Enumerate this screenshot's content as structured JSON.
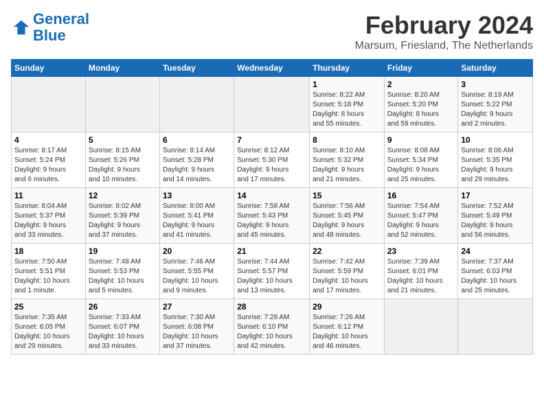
{
  "header": {
    "logo_line1": "General",
    "logo_line2": "Blue",
    "title": "February 2024",
    "subtitle": "Marsum, Friesland, The Netherlands"
  },
  "days_of_week": [
    "Sunday",
    "Monday",
    "Tuesday",
    "Wednesday",
    "Thursday",
    "Friday",
    "Saturday"
  ],
  "weeks": [
    [
      {
        "day": "",
        "info": ""
      },
      {
        "day": "",
        "info": ""
      },
      {
        "day": "",
        "info": ""
      },
      {
        "day": "",
        "info": ""
      },
      {
        "day": "1",
        "info": "Sunrise: 8:22 AM\nSunset: 5:18 PM\nDaylight: 8 hours\nand 55 minutes."
      },
      {
        "day": "2",
        "info": "Sunrise: 8:20 AM\nSunset: 5:20 PM\nDaylight: 8 hours\nand 59 minutes."
      },
      {
        "day": "3",
        "info": "Sunrise: 8:19 AM\nSunset: 5:22 PM\nDaylight: 9 hours\nand 2 minutes."
      }
    ],
    [
      {
        "day": "4",
        "info": "Sunrise: 8:17 AM\nSunset: 5:24 PM\nDaylight: 9 hours\nand 6 minutes."
      },
      {
        "day": "5",
        "info": "Sunrise: 8:15 AM\nSunset: 5:26 PM\nDaylight: 9 hours\nand 10 minutes."
      },
      {
        "day": "6",
        "info": "Sunrise: 8:14 AM\nSunset: 5:28 PM\nDaylight: 9 hours\nand 14 minutes."
      },
      {
        "day": "7",
        "info": "Sunrise: 8:12 AM\nSunset: 5:30 PM\nDaylight: 9 hours\nand 17 minutes."
      },
      {
        "day": "8",
        "info": "Sunrise: 8:10 AM\nSunset: 5:32 PM\nDaylight: 9 hours\nand 21 minutes."
      },
      {
        "day": "9",
        "info": "Sunrise: 8:08 AM\nSunset: 5:34 PM\nDaylight: 9 hours\nand 25 minutes."
      },
      {
        "day": "10",
        "info": "Sunrise: 8:06 AM\nSunset: 5:35 PM\nDaylight: 9 hours\nand 29 minutes."
      }
    ],
    [
      {
        "day": "11",
        "info": "Sunrise: 8:04 AM\nSunset: 5:37 PM\nDaylight: 9 hours\nand 33 minutes."
      },
      {
        "day": "12",
        "info": "Sunrise: 8:02 AM\nSunset: 5:39 PM\nDaylight: 9 hours\nand 37 minutes."
      },
      {
        "day": "13",
        "info": "Sunrise: 8:00 AM\nSunset: 5:41 PM\nDaylight: 9 hours\nand 41 minutes."
      },
      {
        "day": "14",
        "info": "Sunrise: 7:58 AM\nSunset: 5:43 PM\nDaylight: 9 hours\nand 45 minutes."
      },
      {
        "day": "15",
        "info": "Sunrise: 7:56 AM\nSunset: 5:45 PM\nDaylight: 9 hours\nand 48 minutes."
      },
      {
        "day": "16",
        "info": "Sunrise: 7:54 AM\nSunset: 5:47 PM\nDaylight: 9 hours\nand 52 minutes."
      },
      {
        "day": "17",
        "info": "Sunrise: 7:52 AM\nSunset: 5:49 PM\nDaylight: 9 hours\nand 56 minutes."
      }
    ],
    [
      {
        "day": "18",
        "info": "Sunrise: 7:50 AM\nSunset: 5:51 PM\nDaylight: 10 hours\nand 1 minute."
      },
      {
        "day": "19",
        "info": "Sunrise: 7:48 AM\nSunset: 5:53 PM\nDaylight: 10 hours\nand 5 minutes."
      },
      {
        "day": "20",
        "info": "Sunrise: 7:46 AM\nSunset: 5:55 PM\nDaylight: 10 hours\nand 9 minutes."
      },
      {
        "day": "21",
        "info": "Sunrise: 7:44 AM\nSunset: 5:57 PM\nDaylight: 10 hours\nand 13 minutes."
      },
      {
        "day": "22",
        "info": "Sunrise: 7:42 AM\nSunset: 5:59 PM\nDaylight: 10 hours\nand 17 minutes."
      },
      {
        "day": "23",
        "info": "Sunrise: 7:39 AM\nSunset: 6:01 PM\nDaylight: 10 hours\nand 21 minutes."
      },
      {
        "day": "24",
        "info": "Sunrise: 7:37 AM\nSunset: 6:03 PM\nDaylight: 10 hours\nand 25 minutes."
      }
    ],
    [
      {
        "day": "25",
        "info": "Sunrise: 7:35 AM\nSunset: 6:05 PM\nDaylight: 10 hours\nand 29 minutes."
      },
      {
        "day": "26",
        "info": "Sunrise: 7:33 AM\nSunset: 6:07 PM\nDaylight: 10 hours\nand 33 minutes."
      },
      {
        "day": "27",
        "info": "Sunrise: 7:30 AM\nSunset: 6:08 PM\nDaylight: 10 hours\nand 37 minutes."
      },
      {
        "day": "28",
        "info": "Sunrise: 7:28 AM\nSunset: 6:10 PM\nDaylight: 10 hours\nand 42 minutes."
      },
      {
        "day": "29",
        "info": "Sunrise: 7:26 AM\nSunset: 6:12 PM\nDaylight: 10 hours\nand 46 minutes."
      },
      {
        "day": "",
        "info": ""
      },
      {
        "day": "",
        "info": ""
      }
    ]
  ]
}
